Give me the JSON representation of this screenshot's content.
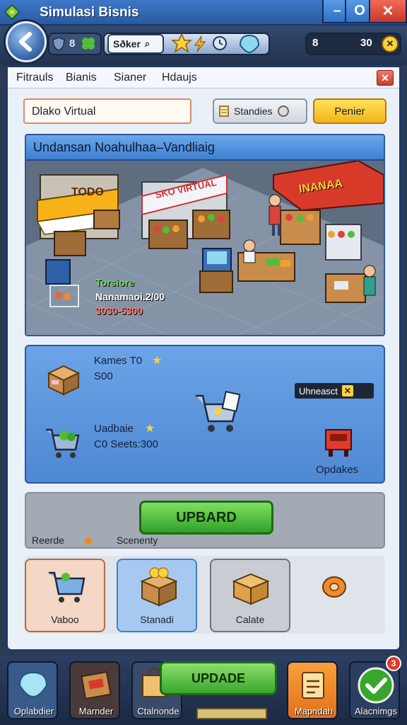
{
  "window": {
    "title": "Simulasi Bisnis",
    "min_glyph": "–",
    "max_glyph": "O",
    "close_glyph": "✕"
  },
  "hud": {
    "left_value": "8",
    "search_chip": "Sðker",
    "currency_label": "8",
    "currency_value": "30"
  },
  "menu": {
    "items": [
      "Fitrauls",
      "Bianis",
      "Sianer",
      "Hdaujs"
    ],
    "close_glyph": "✕"
  },
  "form": {
    "name_value": "Dlako Virtual",
    "standies_label": "Standies",
    "penier_label": "Penier"
  },
  "scene": {
    "header": "Undansan Noahulhaa–Vandliaig",
    "store_left_sign": "TODO",
    "store_mid_sign": "SKO VIRTUAL",
    "store_right_sign": "INANAA",
    "stats_name": "Torsiore",
    "stats_line": "Nanamaoi.2/00",
    "stats_price": "3030-5300"
  },
  "info": {
    "item1_title": "Kames T0",
    "item1_value": "S00",
    "item2_title": "Uadbaie",
    "item2_value": "C0 Seets:300",
    "unlock_label": "Uhneasct",
    "unlock_icon": "✕",
    "update_label": "Opdakes"
  },
  "upgrade": {
    "button": "UPBARD",
    "left_label": "Reerde",
    "right_label": "Scenenty"
  },
  "cards": [
    {
      "label": "Vaboo"
    },
    {
      "label": "Stanadi"
    },
    {
      "label": "Calate"
    }
  ],
  "dock": {
    "items": [
      {
        "label": "Oplabdier"
      },
      {
        "label": "Marnder"
      },
      {
        "label": "Ctalnonde"
      },
      {
        "label": "Mapndah"
      },
      {
        "label": "Alacnimgs"
      }
    ],
    "update_button": "UPDADE",
    "badge": "3"
  },
  "colors": {
    "accent_blue": "#3f7fd0",
    "upgrade_green": "#32a02a",
    "penier_yellow": "#f3b318",
    "close_red": "#c9382a"
  }
}
